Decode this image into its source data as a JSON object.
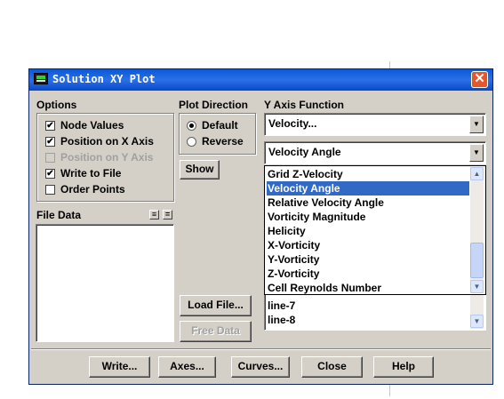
{
  "window": {
    "title": "Solution XY Plot",
    "close_glyph": "✕"
  },
  "options": {
    "label": "Options",
    "items": [
      {
        "label": "Node Values",
        "checked": true,
        "enabled": true
      },
      {
        "label": "Position on X Axis",
        "checked": true,
        "enabled": true
      },
      {
        "label": "Position on Y Axis",
        "checked": false,
        "enabled": false
      },
      {
        "label": "Write to File",
        "checked": true,
        "enabled": true
      },
      {
        "label": "Order Points",
        "checked": false,
        "enabled": true
      }
    ]
  },
  "plot_direction": {
    "label": "Plot Direction",
    "items": [
      {
        "label": "Default",
        "selected": true
      },
      {
        "label": "Reverse",
        "selected": false
      }
    ]
  },
  "y_axis": {
    "label": "Y Axis Function",
    "category_value": "Velocity...",
    "function_value": "Velocity Angle",
    "dropdown_items": [
      "Grid Z-Velocity",
      "Velocity Angle",
      "Relative Velocity Angle",
      "Vorticity Magnitude",
      "Helicity",
      "X-Vorticity",
      "Y-Vorticity",
      "Z-Vorticity",
      "Cell Reynolds Number"
    ],
    "selected_item": "Velocity Angle"
  },
  "surfaces": {
    "items": [
      "line-7",
      "line-8"
    ]
  },
  "file_data": {
    "label": "File Data"
  },
  "buttons": {
    "show": "Show",
    "load_file": "Load File...",
    "free_data": "Free Data",
    "write": "Write...",
    "axes": "Axes...",
    "curves": "Curves...",
    "close": "Close",
    "help": "Help"
  },
  "icons": {
    "check": "✔",
    "arrow_down": "▼",
    "arrow_up": "▲",
    "list_all": "≡",
    "list_none": "="
  },
  "colors": {
    "title_bar": "#0a58d8",
    "selection": "#316ac5",
    "dialog_bg": "#d4d0c8",
    "close_button": "#e4572e"
  }
}
